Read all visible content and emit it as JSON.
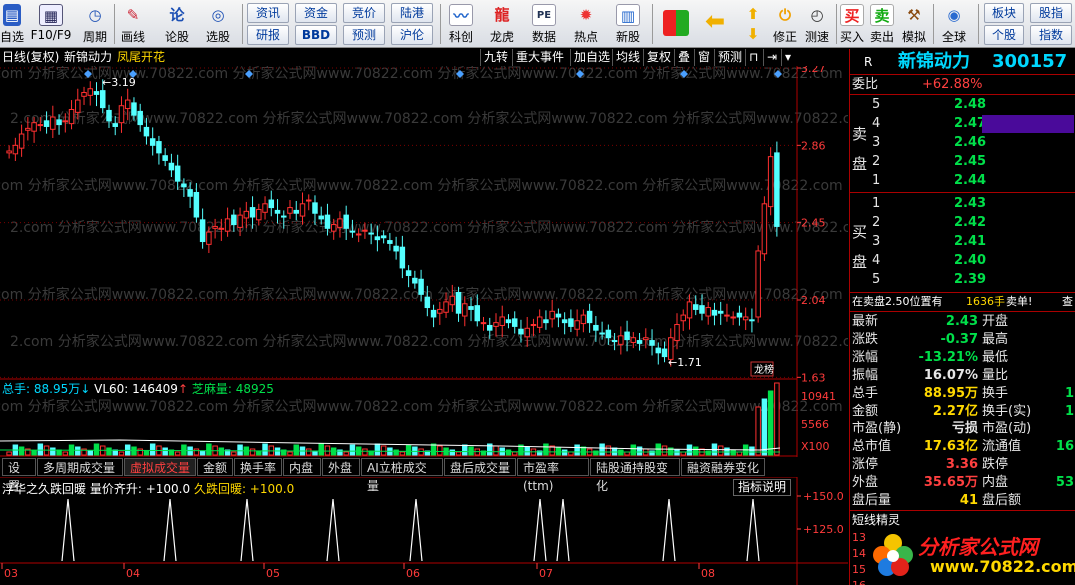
{
  "toolbar": {
    "items": [
      {
        "label": "自选",
        "icon": "watchlist-icon"
      },
      {
        "label": "F10/F9",
        "icon": "f10-icon"
      },
      {
        "label": "周期",
        "icon": "clock-icon"
      },
      {
        "label": "画线",
        "icon": "pencil-icon"
      },
      {
        "label": "论股",
        "icon": "chat-icon"
      },
      {
        "label": "选股",
        "icon": "filter-icon"
      }
    ],
    "small_buttons": [
      "资讯",
      "资金",
      "竞价",
      "陆港",
      "研报",
      "BBD",
      "预测",
      "沪伦"
    ],
    "items2": [
      {
        "label": "科创",
        "icon": "chart-icon"
      },
      {
        "label": "龙虎",
        "icon": "dragon-icon"
      },
      {
        "label": "数据",
        "icon": "pe-icon"
      },
      {
        "label": "热点",
        "icon": "fire-icon"
      },
      {
        "label": "新股",
        "icon": "new-stock-icon"
      }
    ],
    "items3": [
      {
        "label": "",
        "icon": "grid-icon"
      },
      {
        "label": "",
        "icon": "back-arrow-icon"
      },
      {
        "label": "",
        "icon": "up-down-arrow-icon"
      },
      {
        "label": "修正",
        "icon": "restore-icon"
      },
      {
        "label": "测速",
        "icon": "speed-clock-icon"
      },
      {
        "label": "买入",
        "icon": "buy-icon"
      },
      {
        "label": "卖出",
        "icon": "sell-icon"
      },
      {
        "label": "模拟",
        "icon": "hammer-icon"
      },
      {
        "label": "全球",
        "icon": "globe-icon"
      }
    ],
    "right_buttons": [
      "板块",
      "股指",
      "个股",
      "指数"
    ]
  },
  "chart_header": {
    "period": "日线(复权)",
    "name": "新锦动力",
    "pattern": "凤尾开花",
    "buttons": [
      "九转",
      "重大事件",
      "加自选",
      "均线",
      "复权",
      "叠",
      "窗",
      "预测"
    ]
  },
  "price_axis": {
    "labels": [
      "3.27",
      "2.86",
      "2.45",
      "2.04",
      "1.63"
    ]
  },
  "annotations": {
    "high": "3.19",
    "low": "1.71",
    "rank": "龙榜"
  },
  "watermark": "2.com 分析家公式网www.70822.com 分析家公式网www.70822.com 分析家公式网www.70822.com 分析家公式网www.70822.com",
  "volume": {
    "legend_total": "总手: 88.95万",
    "legend_vl60": "VL60: 146409",
    "legend_zhima": "芝麻量: 48925",
    "axis_labels": [
      "10941",
      "5566",
      "X100"
    ]
  },
  "tabs": [
    "设置",
    "多周期成交量",
    "虚拟成交量",
    "金额",
    "换手率",
    "内盘",
    "外盘",
    "AI立桩成交量",
    "盘后成交量",
    "市盈率(ttm)",
    "陆股通持股变化",
    "融资融券变化"
  ],
  "active_tab": "虚拟成交量",
  "indicator": {
    "title": "浮华之久跌回暖",
    "text1": "量价齐升: +100.0",
    "text2": "久跌回暖: +100.0",
    "button": "指标说明",
    "axis_labels": [
      "+150.0",
      "+125.0"
    ]
  },
  "x_axis": [
    "03",
    "04",
    "05",
    "06",
    "07",
    "08"
  ],
  "panel": {
    "r_label": "R",
    "stock_name": "新锦动力",
    "stock_code": "300157",
    "weibi_label": "委比",
    "weibi_value": "+62.88%",
    "sell_label": "卖盘",
    "buy_label": "买盘",
    "sell_levels": [
      {
        "n": "5",
        "price": "2.48"
      },
      {
        "n": "4",
        "price": "2.47"
      },
      {
        "n": "3",
        "price": "2.46"
      },
      {
        "n": "2",
        "price": "2.45"
      },
      {
        "n": "1",
        "price": "2.44"
      }
    ],
    "buy_levels": [
      {
        "n": "1",
        "price": "2.43"
      },
      {
        "n": "2",
        "price": "2.42"
      },
      {
        "n": "3",
        "price": "2.41"
      },
      {
        "n": "4",
        "price": "2.40"
      },
      {
        "n": "5",
        "price": "2.39"
      }
    ],
    "notice": "在卖盘2.50位置有",
    "notice_amount": "1636手",
    "notice_type": "卖单!",
    "notice_query": "查",
    "stats": [
      {
        "l1": "最新",
        "v1": "2.43",
        "c1": "g",
        "l2": "开盘",
        "v2": ""
      },
      {
        "l1": "涨跌",
        "v1": "-0.37",
        "c1": "g",
        "l2": "最高",
        "v2": ""
      },
      {
        "l1": "涨幅",
        "v1": "-13.21%",
        "c1": "g",
        "l2": "最低",
        "v2": ""
      },
      {
        "l1": "振幅",
        "v1": "16.07%",
        "c1": "w",
        "l2": "量比",
        "v2": ""
      },
      {
        "l1": "总手",
        "v1": "88.95万",
        "c1": "y",
        "l2": "换手",
        "v2": "1"
      },
      {
        "l1": "金额",
        "v1": "2.27亿",
        "c1": "y",
        "l2": "换手(实)",
        "v2": "1"
      },
      {
        "l1": "市盈(静)",
        "v1": "亏损",
        "c1": "w",
        "l2": "市盈(动)",
        "v2": ""
      },
      {
        "l1": "总市值",
        "v1": "17.63亿",
        "c1": "y",
        "l2": "流通值",
        "v2": "16"
      },
      {
        "l1": "涨停",
        "v1": "3.36",
        "c1": "r",
        "l2": "跌停",
        "v2": ""
      },
      {
        "l1": "外盘",
        "v1": "35.65万",
        "c1": "r",
        "l2": "内盘",
        "v2": "53"
      },
      {
        "l1": "盘后量",
        "v1": "41",
        "c1": "y",
        "l2": "盘后额",
        "v2": ""
      }
    ],
    "bottom_title": "短线精灵",
    "bottom_rows": [
      "13",
      "14",
      "15",
      "16"
    ],
    "logo_text": "分析家公式网",
    "logo_url": "www.70822.com"
  }
}
